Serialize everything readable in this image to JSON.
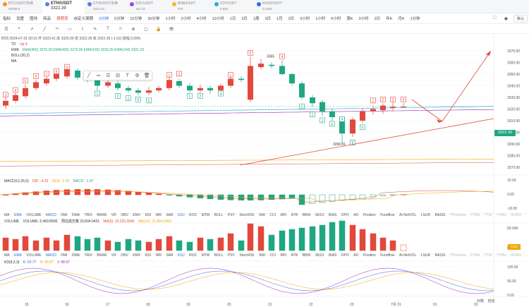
{
  "tickers": [
    {
      "name": "BTC/USDT永续",
      "price": "65299.6",
      "color": "#f7931a"
    },
    {
      "name": "ETH/USDT",
      "price": "3322.39",
      "color": "#627eea",
      "active": true
    },
    {
      "name": "ETH/USDT永续",
      "price": "3324.01",
      "color": "#627eea"
    },
    {
      "name": "SOL/USDT",
      "price": "181.22",
      "color": "#9945ff"
    },
    {
      "name": "BNB/USDT",
      "price": "575",
      "color": "#f3ba2f"
    },
    {
      "name": "ICP/USDT",
      "price": "9.883",
      "color": "#29abe2"
    },
    {
      "name": "RSS3/USDT",
      "price": "0.1609",
      "color": "#2a6df4"
    }
  ],
  "toolbar": {
    "items": [
      "指标",
      "设置",
      "图线",
      "商品",
      "周期率",
      "自定义周期",
      "3分钟",
      "5分钟",
      "15分钟",
      "30分钟",
      "1小时",
      "2小时",
      "4小时",
      "12小时",
      "1日",
      "3日",
      "1周",
      "3日",
      "1月",
      "2日",
      "3小时",
      "1小时",
      "6小时",
      "周K",
      "3小时",
      "2日",
      "年K",
      "月K",
      "1分钟"
    ],
    "selected_index": 6,
    "accent_index": 4,
    "right_select": "默认"
  },
  "drawbar": [
    "☰",
    "+",
    "↗",
    "╱",
    "═",
    "▭",
    "⌇",
    "✎",
    "T",
    "☺",
    "⊕",
    "▢",
    "🔒",
    "👁"
  ],
  "info": {
    "line1": "时间 2024-07-31 00:15  开 3323.41  高 3325.00  低 3322.39  收 3322.39  (-1.02)  振幅 0.09%",
    "td": "TD",
    "td_extra": "Up 4",
    "ema": "EMA",
    "ema_values": "EMA(450) 3276.28  EMA(400) 3279.06  EMA(169) 3318.25  EMA(144) 3321.33",
    "boll": "BOLL(20,2)",
    "ma": "MA"
  },
  "price_axis": [
    "3370.00",
    "3360.00",
    "3350.00",
    "3340.00",
    "3330.00",
    "3320.00",
    "3310.00",
    "3300.00",
    "3290.00",
    "3280.00",
    "3270.00"
  ],
  "current_price": "3322.39",
  "annotations": {
    "high": "3365",
    "low": "3290.01"
  },
  "macd": {
    "label": "MACD(12,26,9)",
    "dif": "DIF: -4.25",
    "dea": "DEA: -2.28",
    "macd": "MACD: -1.97",
    "axis": [
      "10.00",
      "0.00",
      "-10.00"
    ]
  },
  "volume": {
    "label": "VOLUME",
    "v1": "VOLUME: 5,469.8500",
    "v2": "预估成交量 23,004.0421",
    "ma5": "MA(5): 15,225.3946",
    "ma10": "MA(10): 31,494.6403",
    "axis": [
      "50.00K",
      "0.00"
    ],
    "last": "5.5K"
  },
  "kd": {
    "label": "KD(9,3,3)",
    "k": "K: 62.77",
    "d": "D: 40.67",
    "j": "J: 98.97",
    "axis": [
      "100.00",
      "50.00",
      "0.00"
    ]
  },
  "indicator_tabs": [
    "MA",
    "EMA",
    "VOLUME",
    "MACD",
    "DMI",
    "DMA",
    "TRIX",
    "BRAR",
    "VR",
    "OBV",
    "EMV",
    "RSI",
    "WR",
    "SAR",
    "KDJ",
    "ROC",
    "MTM",
    "BOLL",
    "PSY",
    "StochRSI",
    "SMI",
    "CCI",
    "MFI",
    "ATR",
    "BBW",
    "SKDJ",
    "BIAS",
    "DPO",
    "AO",
    "Position",
    "Fundflow",
    "AI-NetVOL",
    "LSUR",
    "BASIS",
    "TPVolume",
    "FTBS",
    "TTSI",
    "TTMU",
    "AI-BSI"
  ],
  "indicator_active": [
    1,
    3,
    14
  ],
  "x_axis": [
    "15",
    "16",
    "17",
    "18",
    "19",
    "20",
    "21",
    "22",
    "23",
    "7月 31",
    "01",
    "02"
  ],
  "bottom_right": [
    "对数",
    "自动"
  ],
  "colors": {
    "up": "#1fa783",
    "down": "#e2483b",
    "accent": "#2f6fde"
  }
}
